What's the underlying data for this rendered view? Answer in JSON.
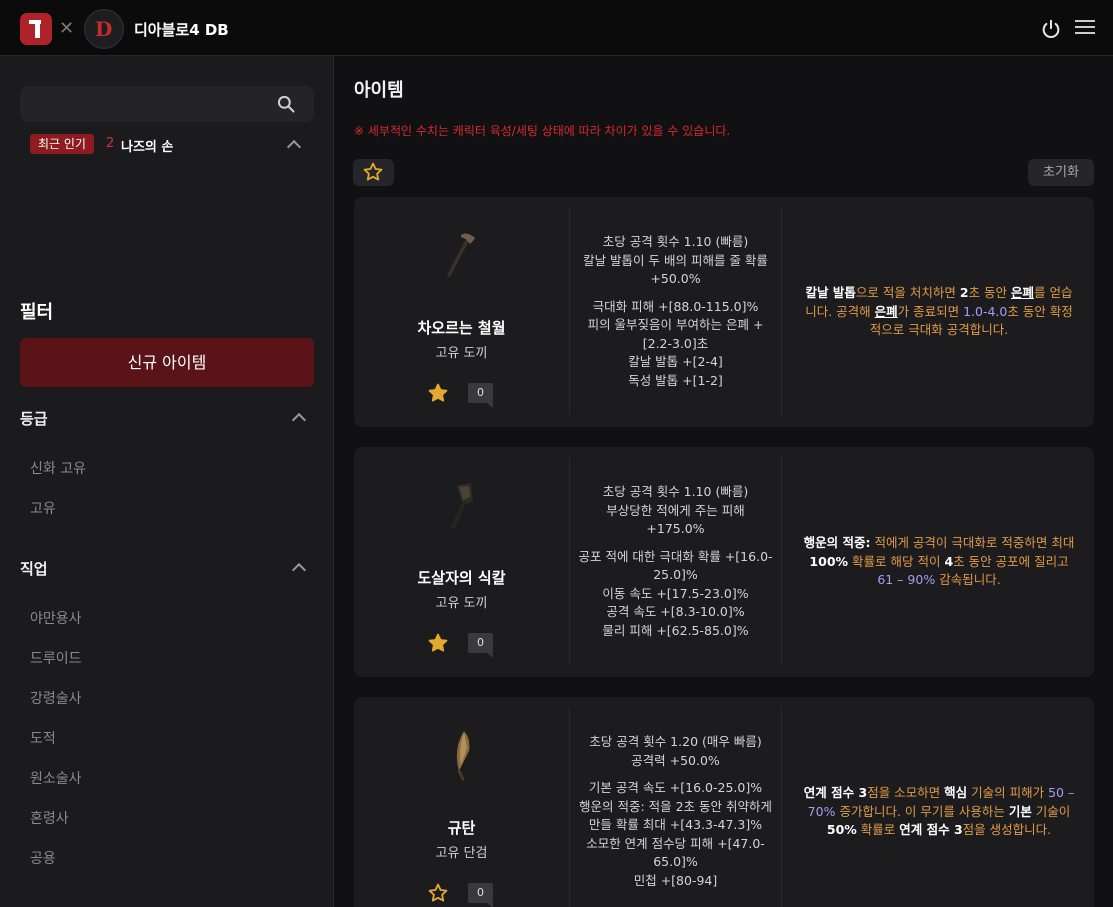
{
  "header": {
    "app_title": "디아블로4 DB",
    "logo_letter": "D"
  },
  "sidebar": {
    "search_placeholder": "",
    "trending": {
      "badge": "최근 인기",
      "rank": "2",
      "name": "나즈의 손"
    },
    "filter_title": "필터",
    "new_items_button": "신규 아이템",
    "grade": {
      "title": "등급",
      "items": [
        "신화 고유",
        "고유"
      ]
    },
    "class": {
      "title": "직업",
      "items": [
        "야만용사",
        "드루이드",
        "강령술사",
        "도적",
        "원소술사",
        "혼령사",
        "공용"
      ]
    }
  },
  "main": {
    "title": "아이템",
    "notice": "※ 세부적인 수치는 캐릭터 육성/세팅 상태에 따라 차이가 있을 수 있습니다.",
    "reset_button": "초기화",
    "items": [
      {
        "name": "차오르는 철월",
        "type": "고유 도끼",
        "comments": "0",
        "favorited": true,
        "icon": "axe-icon",
        "base_stats": [
          "초당 공격 횟수 1.10 (빠름)",
          "칼날 발톱이 두 배의 피해를 줄 확률 +50.0%"
        ],
        "affixes": [
          "극대화 피해 +[88.0-115.0]%",
          "피의 울부짖음이 부여하는 은폐 +[2.2-3.0]초",
          "칼날 발톱 +[2-4]",
          "독성 발톱 +[1-2]"
        ],
        "unique_effect": [
          {
            "t": "칼날 발톱",
            "c": "w"
          },
          {
            "t": "으로 적을 처치하면 ",
            "c": "o"
          },
          {
            "t": "2",
            "c": "w"
          },
          {
            "t": "초 동안 ",
            "c": "o"
          },
          {
            "t": "은폐",
            "c": "wu"
          },
          {
            "t": "를 얻습니다. 공격해 ",
            "c": "o"
          },
          {
            "t": "은폐",
            "c": "wu"
          },
          {
            "t": "가 종료되면 ",
            "c": "o"
          },
          {
            "t": "1.0-4.0",
            "c": "p"
          },
          {
            "t": "초 동안 확정적으로 극대화 공격합니다.",
            "c": "o"
          }
        ]
      },
      {
        "name": "도살자의 식칼",
        "type": "고유 도끼",
        "comments": "0",
        "favorited": true,
        "icon": "cleaver-icon",
        "base_stats": [
          "초당 공격 횟수 1.10 (빠름)",
          "부상당한 적에게 주는 피해 +175.0%"
        ],
        "affixes": [
          "공포 적에 대한 극대화 확률 +[16.0-25.0]%",
          "이동 속도 +[17.5-23.0]%",
          "공격 속도 +[8.3-10.0]%",
          "물리 피해 +[62.5-85.0]%"
        ],
        "unique_effect": [
          {
            "t": "행운의 적중:",
            "c": "w"
          },
          {
            "t": " 적에게 공격이 극대화로 적중하면 최대 ",
            "c": "o"
          },
          {
            "t": "100%",
            "c": "w"
          },
          {
            "t": " 확률로 해당 적이 ",
            "c": "o"
          },
          {
            "t": "4",
            "c": "w"
          },
          {
            "t": "초 동안 공포에 질리고 ",
            "c": "o"
          },
          {
            "t": "61 – 90%",
            "c": "p"
          },
          {
            "t": " 감속됩니다.",
            "c": "o"
          }
        ]
      },
      {
        "name": "규탄",
        "type": "고유 단검",
        "comments": "0",
        "favorited": false,
        "icon": "dagger-icon",
        "base_stats": [
          "초당 공격 횟수 1.20 (매우 빠름)",
          "공격력 +50.0%"
        ],
        "affixes": [
          "기본 공격 속도 +[16.0-25.0]%",
          "행운의 적중: 적을 2초 동안 취약하게 만들 확률 최대 +[43.3-47.3]%",
          "소모한 연계 점수당 피해 +[47.0-65.0]%",
          "민첩 +[80-94]"
        ],
        "unique_effect": [
          {
            "t": "연계 점수",
            "c": "w"
          },
          {
            "t": " 3",
            "c": "w"
          },
          {
            "t": "점을 소모하면 ",
            "c": "o"
          },
          {
            "t": "핵심",
            "c": "w"
          },
          {
            "t": " 기술의 피해가 ",
            "c": "o"
          },
          {
            "t": "50 –70%",
            "c": "p"
          },
          {
            "t": " 증가합니다. 이 무기를 사용하는 ",
            "c": "o"
          },
          {
            "t": "기본",
            "c": "w"
          },
          {
            "t": " 기술이 ",
            "c": "o"
          },
          {
            "t": "50%",
            "c": "w"
          },
          {
            "t": " 확률로 ",
            "c": "o"
          },
          {
            "t": "연계 점수",
            "c": "w"
          },
          {
            "t": " 3",
            "c": "w"
          },
          {
            "t": "점을 생성합니다.",
            "c": "o"
          }
        ]
      }
    ]
  },
  "colors": {
    "accent_red": "#8e1b20",
    "effect_orange": "#e09a46",
    "value_purple": "#a69cf0",
    "star_gold": "#e2a92e"
  }
}
